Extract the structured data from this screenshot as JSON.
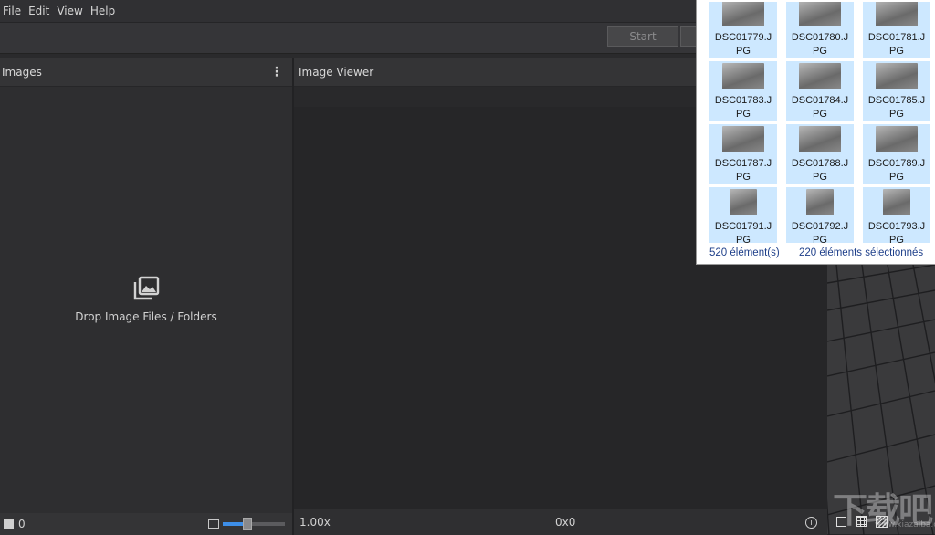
{
  "menu": [
    "File",
    "Edit",
    "View",
    "Help"
  ],
  "toolbar": {
    "start_label": "Start"
  },
  "images_panel": {
    "title": "Images",
    "drop_label": "Drop Image Files / Folders",
    "count": "0",
    "thumbnail_size": 0.4
  },
  "viewer": {
    "title": "Image Viewer",
    "zoom": "1.00x",
    "resolution": "0x0"
  },
  "explorer": {
    "files": [
      "DSC01779.JPG",
      "DSC01780.JPG",
      "DSC01781.JPG",
      "DSC01783.JPG",
      "DSC01784.JPG",
      "DSC01785.JPG",
      "DSC01787.JPG",
      "DSC01788.JPG",
      "DSC01789.JPG",
      "DSC01791.JPG",
      "DSC01792.JPG",
      "DSC01793.JPG"
    ],
    "item_count": "520 élément(s)",
    "selected": "220 éléments sélectionnés",
    "selection_color": "#cde8ff"
  },
  "watermark": {
    "text": "下载吧",
    "url": "www.xiazaiba.com"
  }
}
